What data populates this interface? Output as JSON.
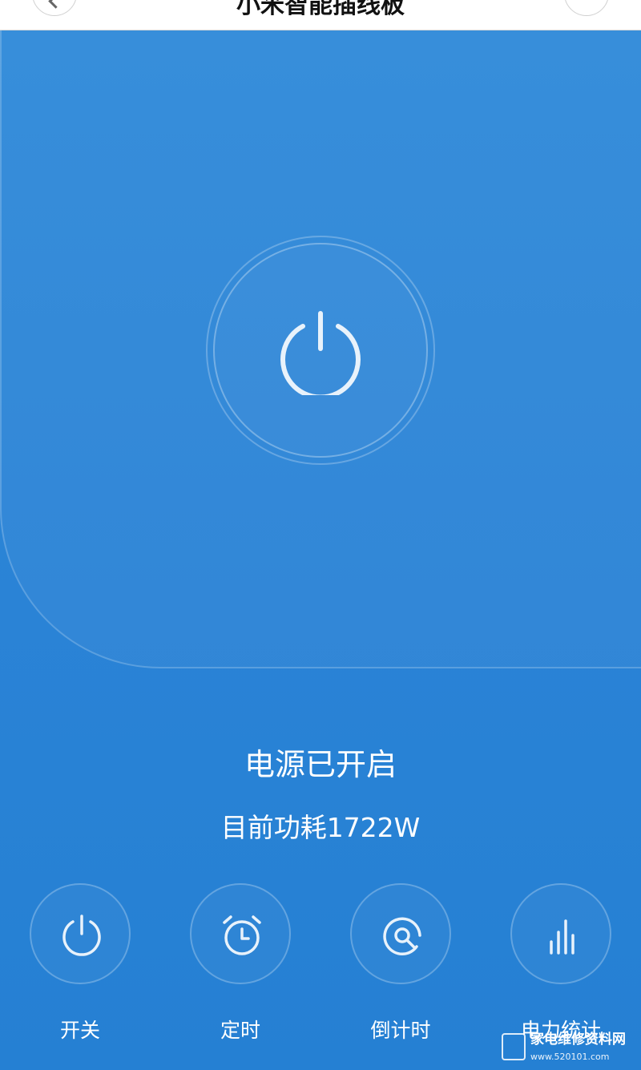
{
  "header": {
    "title": "小米智能插线板"
  },
  "power": {
    "status_text": "电源已开启",
    "consumption_text": "目前功耗1722W"
  },
  "actions": [
    {
      "label": "开关",
      "icon": "power-icon"
    },
    {
      "label": "定时",
      "icon": "alarm-clock-icon"
    },
    {
      "label": "倒计时",
      "icon": "countdown-icon"
    },
    {
      "label": "电力统计",
      "icon": "bar-chart-icon"
    }
  ],
  "watermark": {
    "text": "家电维修资料网",
    "sub": "www.520101.com"
  },
  "colors": {
    "background": "#2a84d8",
    "icon": "#e8f2fb"
  }
}
